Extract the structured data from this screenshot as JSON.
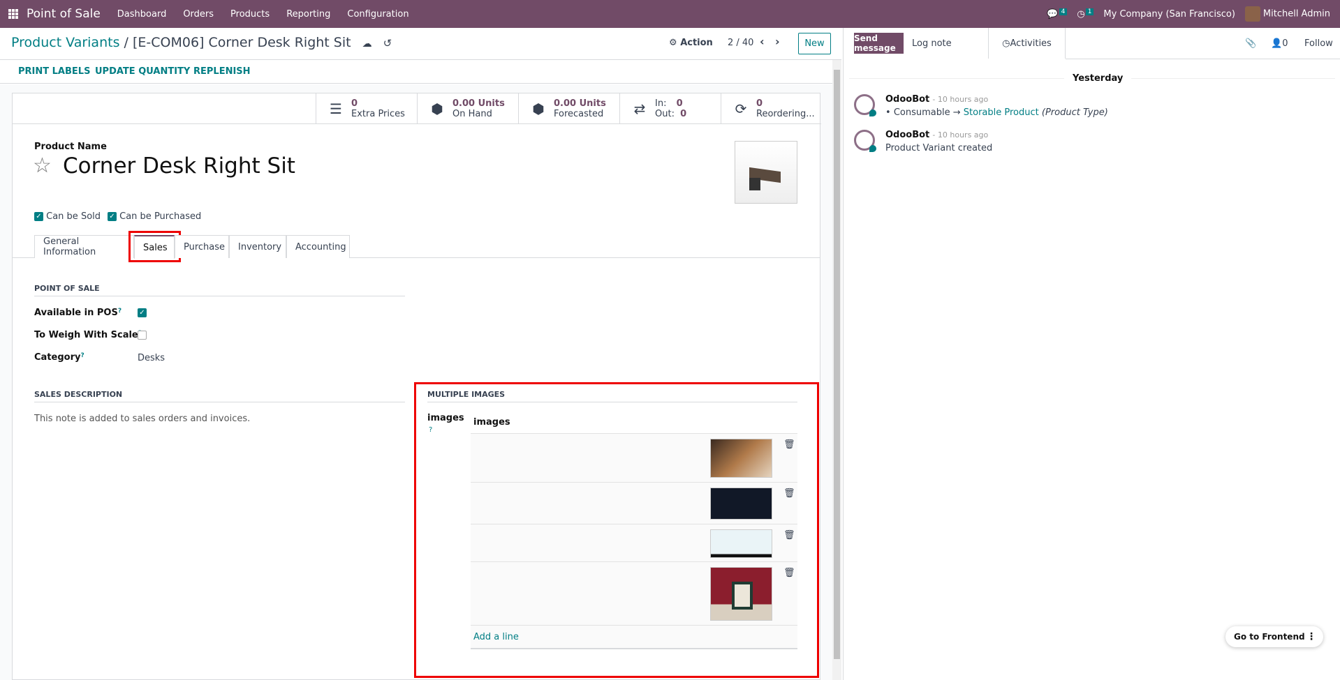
{
  "navbar": {
    "app": "Point of Sale",
    "menu": [
      "Dashboard",
      "Orders",
      "Products",
      "Reporting",
      "Configuration"
    ],
    "messages_count": "4",
    "activities_count": "1",
    "company": "My Company (San Francisco)",
    "user": "Mitchell Admin"
  },
  "control": {
    "breadcrumb_parent": "Product Variants",
    "breadcrumb_sep": "/",
    "record": "[E-COM06] Corner Desk Right Sit",
    "action": "Action",
    "pager": "2 / 40",
    "new": "New"
  },
  "actions": [
    "PRINT LABELS",
    "UPDATE QUANTITY",
    "REPLENISH"
  ],
  "stats": {
    "extra_prices": {
      "value": "0",
      "label": "Extra Prices"
    },
    "on_hand": {
      "value": "0.00 Units",
      "label": "On Hand"
    },
    "forecasted": {
      "value": "0.00 Units",
      "label": "Forecasted"
    },
    "in_label": "In:",
    "in": "0",
    "out_label": "Out:",
    "out": "0",
    "reordering": {
      "value": "0",
      "label": "Reordering..."
    }
  },
  "product": {
    "name_label": "Product Name",
    "name": "Corner Desk Right Sit",
    "can_be_sold": "Can be Sold",
    "can_be_purchased": "Can be Purchased"
  },
  "tabs": [
    "General Information",
    "Sales",
    "Purchase",
    "Inventory",
    "Accounting"
  ],
  "pos": {
    "title": "POINT OF SALE",
    "available": "Available in POS",
    "weigh": "To Weigh With Scale",
    "category_label": "Category",
    "category": "Desks",
    "q": "?"
  },
  "sales_desc": {
    "title": "SALES DESCRIPTION",
    "placeholder": "This note is added to sales orders and invoices."
  },
  "multi": {
    "title": "MULTIPLE IMAGES",
    "label": "images",
    "help": "?",
    "column": "images",
    "add": "Add a line"
  },
  "chatter": {
    "send": "Send message",
    "log": "Log note",
    "activities": "Activities",
    "followers": "0",
    "follow": "Follow",
    "date": "Yesterday",
    "messages": [
      {
        "author": "OdooBot",
        "time": "- 10 hours ago",
        "old": "Consumable",
        "arrow": "→",
        "new": "Storable Product",
        "field": "(Product Type)"
      },
      {
        "author": "OdooBot",
        "time": "- 10 hours ago",
        "body": "Product Variant created"
      }
    ]
  },
  "frontend": "Go to Frontend"
}
